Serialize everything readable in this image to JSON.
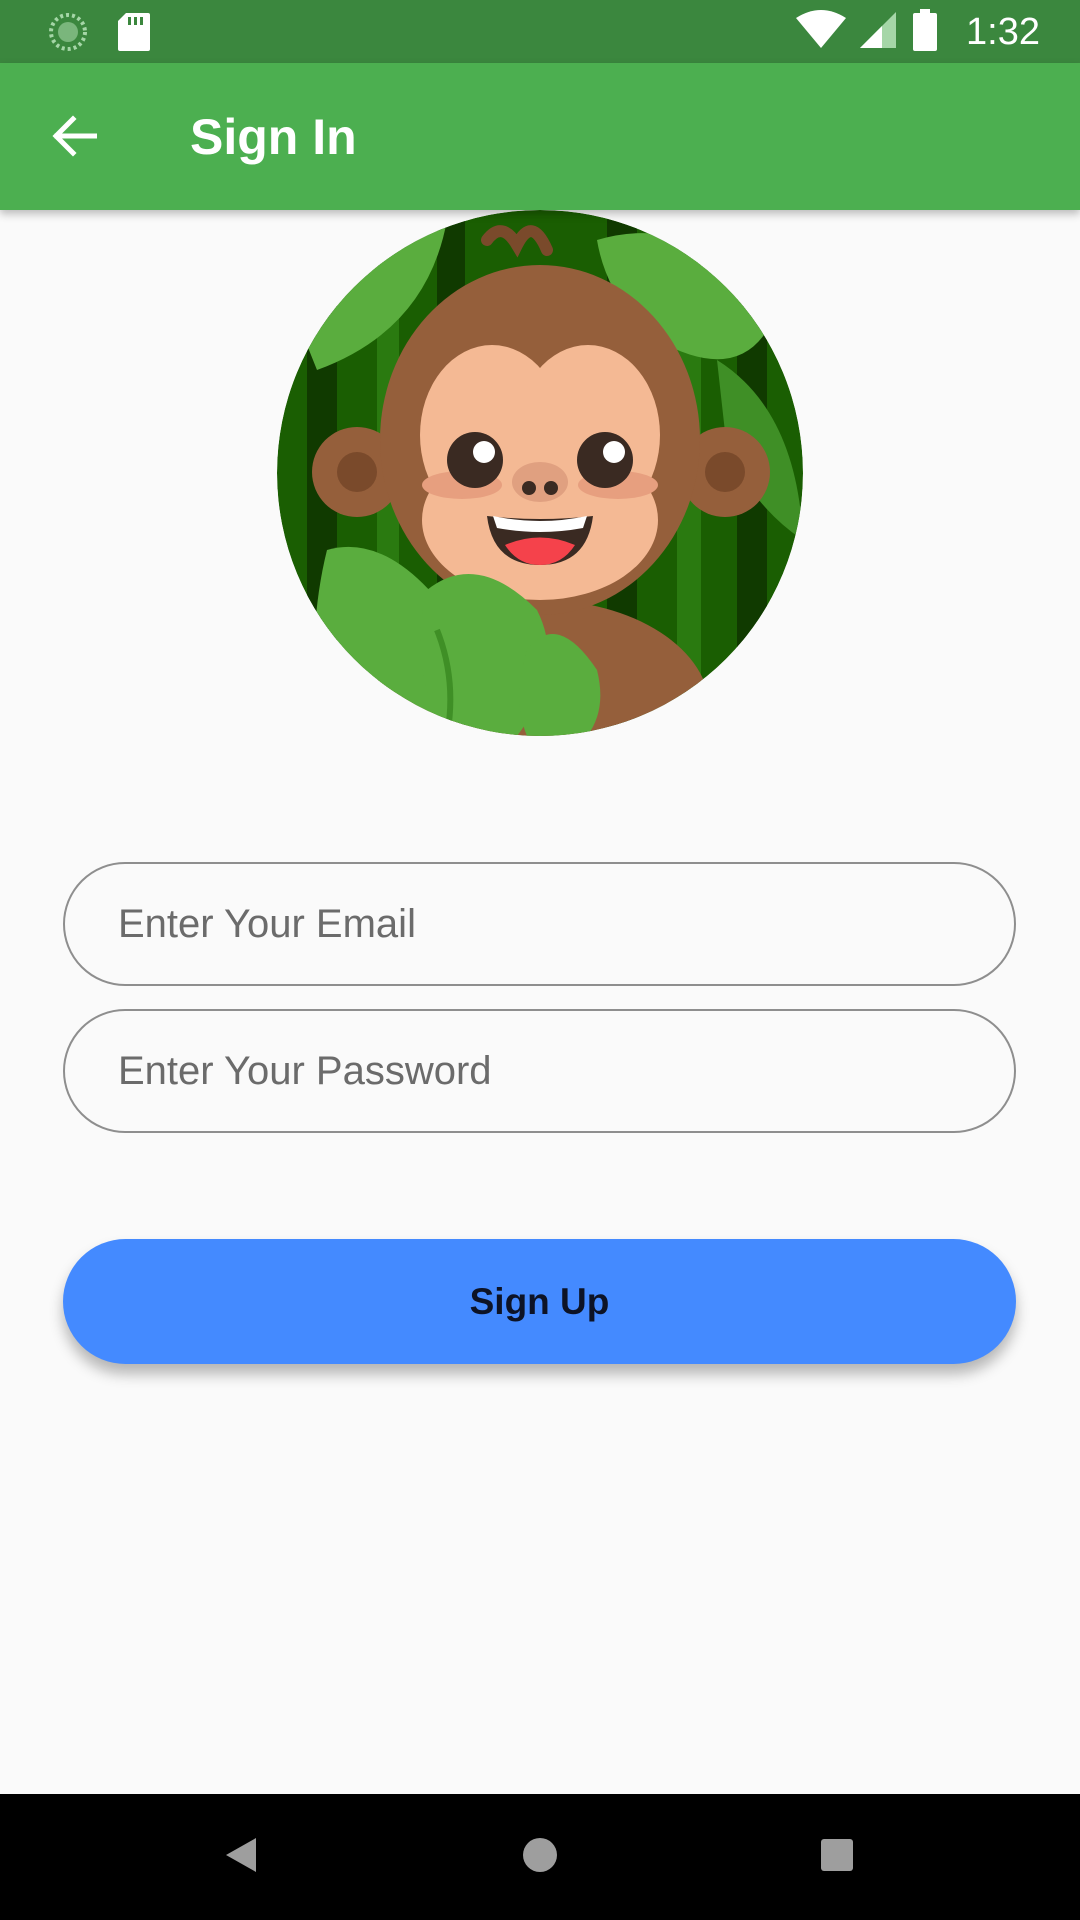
{
  "status_bar": {
    "time": "1:32",
    "icons": [
      "sync-icon",
      "sd-card-icon",
      "wifi-icon",
      "signal-icon",
      "battery-icon"
    ]
  },
  "app_bar": {
    "title": "Sign In",
    "back_icon": "arrow-back-icon",
    "color": "#4caf50"
  },
  "avatar": {
    "icon": "monkey-jungle-avatar"
  },
  "form": {
    "email_placeholder": "Enter Your Email",
    "email_value": "",
    "password_placeholder": "Enter Your Password",
    "password_value": "",
    "submit_label": "Sign Up",
    "submit_color": "#448aff"
  },
  "nav_bar": {
    "icons": [
      "nav-back-icon",
      "nav-home-icon",
      "nav-recents-icon"
    ]
  }
}
